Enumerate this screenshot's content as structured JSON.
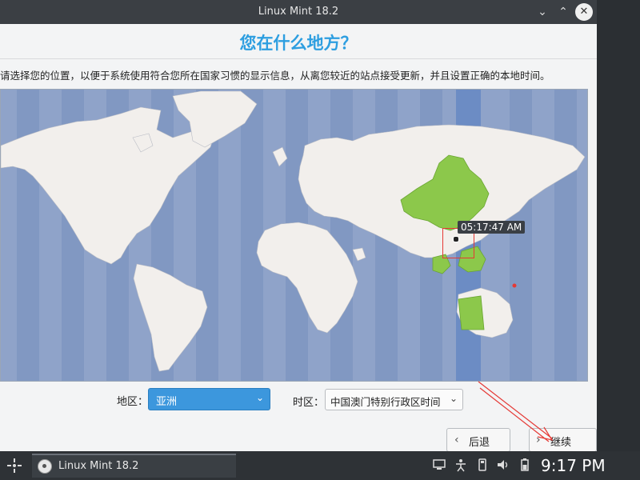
{
  "window": {
    "title": "Linux Mint 18.2",
    "minimize_icon": "chevron-down-icon",
    "maximize_icon": "chevron-up-icon",
    "close_icon": "close-icon"
  },
  "page": {
    "heading": "您在什么地方？",
    "description": "请选择您的位置，以便于系统使用符合您所在国家习惯的显示信息，从离您较近的站点接受更新，并且设置正确的本地时间。"
  },
  "map": {
    "time_label": "05:17:47 AM",
    "highlight_color": "#8cc84b",
    "ocean_color": "#8fa3c9",
    "land_color": "#f2efec",
    "selected_zone_color": "#6c8cc4"
  },
  "form": {
    "region_label": "地区：",
    "region_value": "亚洲",
    "timezone_label": "时区：",
    "timezone_value": "中国澳门特别行政区时间"
  },
  "buttons": {
    "back_label": "后退",
    "next_label": "继续"
  },
  "taskbar": {
    "task_title": "Linux Mint 18.2",
    "clock": "9:17 PM",
    "tray_icons": [
      "network-icon",
      "accessibility-icon",
      "usb-icon",
      "volume-icon",
      "battery-icon"
    ]
  },
  "accent_color": "#3c97dd"
}
